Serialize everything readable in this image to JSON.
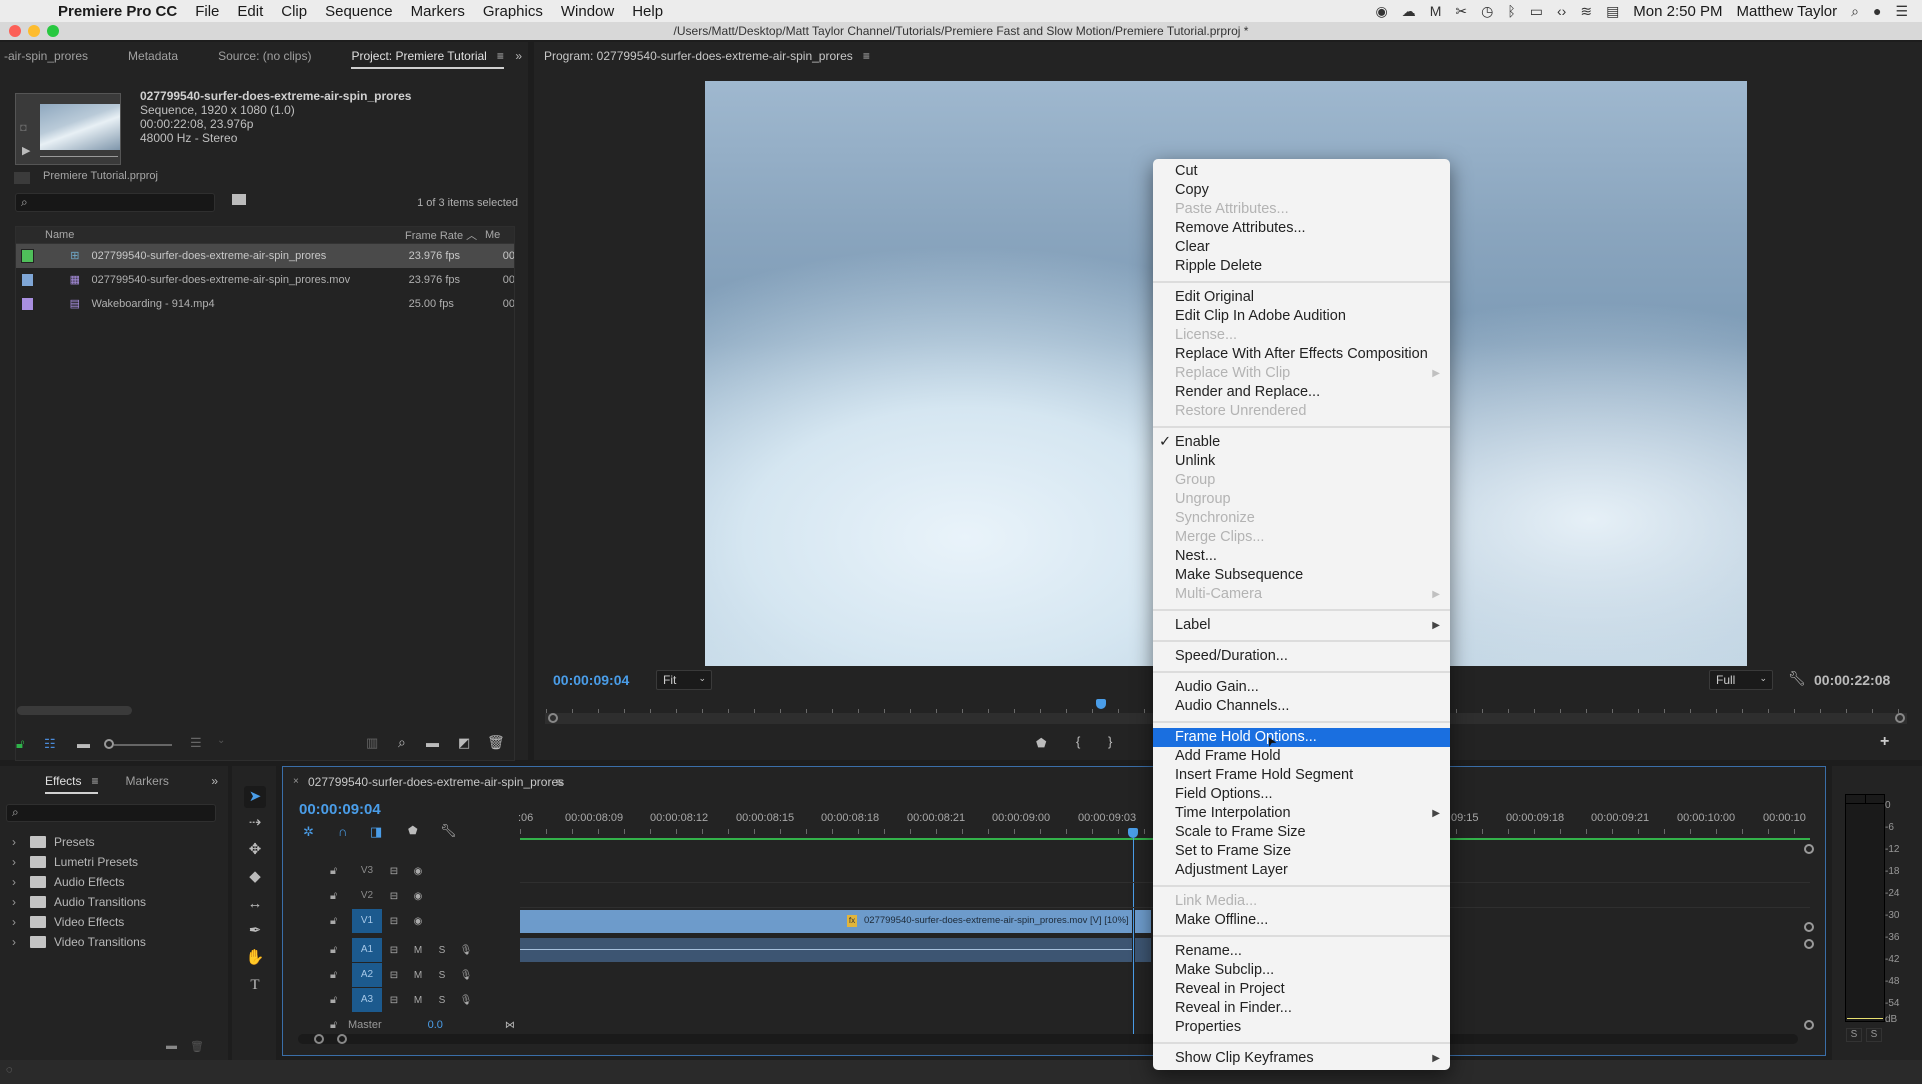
{
  "menubar": {
    "app_name": "Premiere Pro CC",
    "items": [
      "File",
      "Edit",
      "Clip",
      "Sequence",
      "Markers",
      "Graphics",
      "Window",
      "Help"
    ],
    "clock": "Mon 2:50 PM",
    "user": "Matthew Taylor"
  },
  "window": {
    "title": "/Users/Matt/Desktop/Matt Taylor Channel/Tutorials/Premiere Fast and Slow Motion/Premiere Tutorial.prproj *"
  },
  "project_panel": {
    "tabs": [
      "-air-spin_prores",
      "Metadata",
      "Source: (no clips)",
      "Project: Premiere Tutorial"
    ],
    "preview": {
      "name": "027799540-surfer-does-extreme-air-spin_prores",
      "line1": "Sequence, 1920 x 1080 (1.0)",
      "line2": "00:00:22:08, 23.976p",
      "line3": "48000 Hz - Stereo"
    },
    "project_file": "Premiere Tutorial.prproj",
    "search_placeholder": "",
    "selection_status": "1 of 3 items selected",
    "columns": [
      "Name",
      "Frame Rate",
      "Me"
    ],
    "rows": [
      {
        "name": "027799540-surfer-does-extreme-air-spin_prores",
        "frame_rate": "23.976 fps",
        "media": "00",
        "label_color": "#4fbf5a",
        "type": "sequence",
        "selected": true
      },
      {
        "name": "027799540-surfer-does-extreme-air-spin_prores.mov",
        "frame_rate": "23.976 fps",
        "media": "00",
        "label_color": "#7fa6d6",
        "type": "clip",
        "selected": false
      },
      {
        "name": "Wakeboarding - 914.mp4",
        "frame_rate": "25.00 fps",
        "media": "00",
        "label_color": "#a98fe0",
        "type": "clip",
        "selected": false
      }
    ]
  },
  "program_monitor": {
    "title": "Program: 027799540-surfer-does-extreme-air-spin_prores",
    "current_time": "00:00:09:04",
    "zoom": "Fit",
    "resolution": "Full",
    "duration": "00:00:22:08"
  },
  "context_menu": {
    "groups": [
      [
        {
          "label": "Cut",
          "enabled": true
        },
        {
          "label": "Copy",
          "enabled": true
        },
        {
          "label": "Paste Attributes...",
          "enabled": false
        },
        {
          "label": "Remove Attributes...",
          "enabled": true
        },
        {
          "label": "Clear",
          "enabled": true
        },
        {
          "label": "Ripple Delete",
          "enabled": true
        }
      ],
      [
        {
          "label": "Edit Original",
          "enabled": true
        },
        {
          "label": "Edit Clip In Adobe Audition",
          "enabled": true
        },
        {
          "label": "License...",
          "enabled": false
        },
        {
          "label": "Replace With After Effects Composition",
          "enabled": true
        },
        {
          "label": "Replace With Clip",
          "enabled": false,
          "submenu": true
        },
        {
          "label": "Render and Replace...",
          "enabled": true
        },
        {
          "label": "Restore Unrendered",
          "enabled": false
        }
      ],
      [
        {
          "label": "Enable",
          "enabled": true,
          "checked": true
        },
        {
          "label": "Unlink",
          "enabled": true
        },
        {
          "label": "Group",
          "enabled": false
        },
        {
          "label": "Ungroup",
          "enabled": false
        },
        {
          "label": "Synchronize",
          "enabled": false
        },
        {
          "label": "Merge Clips...",
          "enabled": false
        },
        {
          "label": "Nest...",
          "enabled": true
        },
        {
          "label": "Make Subsequence",
          "enabled": true
        },
        {
          "label": "Multi-Camera",
          "enabled": false,
          "submenu": true
        }
      ],
      [
        {
          "label": "Label",
          "enabled": true,
          "submenu": true
        }
      ],
      [
        {
          "label": "Speed/Duration...",
          "enabled": true
        }
      ],
      [
        {
          "label": "Audio Gain...",
          "enabled": true
        },
        {
          "label": "Audio Channels...",
          "enabled": true
        }
      ],
      [
        {
          "label": "Frame Hold Options...",
          "enabled": true,
          "highlighted": true
        },
        {
          "label": "Add Frame Hold",
          "enabled": true
        },
        {
          "label": "Insert Frame Hold Segment",
          "enabled": true
        },
        {
          "label": "Field Options...",
          "enabled": true
        },
        {
          "label": "Time Interpolation",
          "enabled": true,
          "submenu": true
        },
        {
          "label": "Scale to Frame Size",
          "enabled": true
        },
        {
          "label": "Set to Frame Size",
          "enabled": true
        },
        {
          "label": "Adjustment Layer",
          "enabled": true
        }
      ],
      [
        {
          "label": "Link Media...",
          "enabled": false
        },
        {
          "label": "Make Offline...",
          "enabled": true
        }
      ],
      [
        {
          "label": "Rename...",
          "enabled": true
        },
        {
          "label": "Make Subclip...",
          "enabled": true
        },
        {
          "label": "Reveal in Project",
          "enabled": true
        },
        {
          "label": "Reveal in Finder...",
          "enabled": true
        },
        {
          "label": "Properties",
          "enabled": true
        }
      ],
      [
        {
          "label": "Show Clip Keyframes",
          "enabled": true,
          "submenu": true
        }
      ]
    ]
  },
  "effects_panel": {
    "tabs": [
      "Effects",
      "Markers"
    ],
    "items": [
      "Presets",
      "Lumetri Presets",
      "Audio Effects",
      "Audio Transitions",
      "Video Effects",
      "Video Transitions"
    ]
  },
  "timeline": {
    "sequence_name": "027799540-surfer-does-extreme-air-spin_prores",
    "current_time": "00:00:09:04",
    "ruler_labels": [
      ":06",
      "00:00:08:09",
      "00:00:08:12",
      "00:00:08:15",
      "00:00:08:18",
      "00:00:08:21",
      "00:00:09:00",
      "00:00:09:03",
      "09:15",
      "00:00:09:18",
      "00:00:09:21",
      "00:00:10:00",
      "00:00:10"
    ],
    "video_tracks": [
      "V3",
      "V2",
      "V1"
    ],
    "audio_tracks": [
      "A1",
      "A2",
      "A3"
    ],
    "master_label": "Master",
    "master_value": "0.0",
    "clip_label": "027799540-surfer-does-extreme-air-spin_prores.mov [V] [10%]"
  },
  "audio_meter": {
    "scale": [
      "0",
      "-6",
      "-12",
      "-18",
      "-24",
      "-30",
      "-36",
      "-42",
      "-48",
      "-54",
      "dB"
    ],
    "solo": [
      "S",
      "S"
    ]
  }
}
